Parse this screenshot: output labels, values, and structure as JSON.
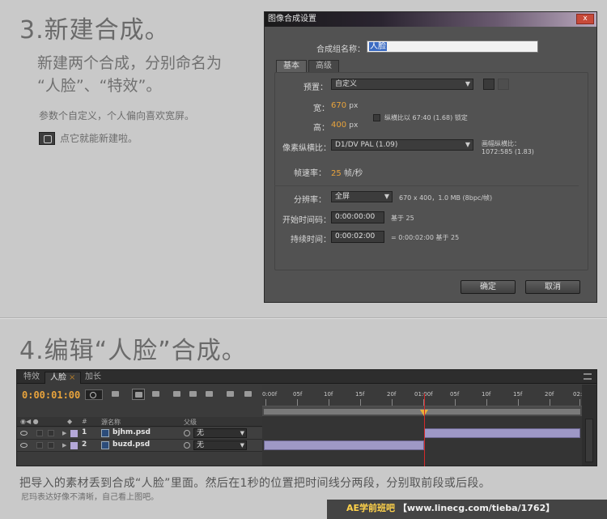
{
  "section3": {
    "title": "3.新建合成。",
    "lead_line1": "新建两个合成，分别命名为",
    "lead_line2": "“人脸”、“特效”。",
    "note": "参数个自定义，个人偏向喜欢宽屏。",
    "hint": "点它就能新建啦。"
  },
  "dialog": {
    "title": "图像合成设置",
    "close_label": "x",
    "name_label": "合成组名称：",
    "name_value": "人脸",
    "tabs": [
      "基本",
      "高级"
    ],
    "preset_label": "预置：",
    "preset_value": "自定义",
    "width_label": "宽：",
    "width_value": "670",
    "height_label": "高：",
    "height_value": "400",
    "unit_px": "px",
    "lock_ratio_label": "纵横比以 67:40 (1.68) 锁定",
    "pixel_aspect_label": "像素纵横比：",
    "pixel_aspect_value": "D1/DV PAL (1.09)",
    "frame_aspect_label": "画幅纵横比：",
    "frame_aspect_value": "1072:585 (1.83)",
    "frame_rate_label": "帧速率：",
    "frame_rate_value": "25",
    "frame_rate_unit": "帧/秒",
    "resolution_label": "分辨率：",
    "resolution_value": "全屏",
    "resolution_info": "670 x 400，1.0 MB (8bpc/帧)",
    "start_timecode_label": "开始时间码：",
    "start_timecode_value": "0:00:00:00",
    "start_timecode_base": "基于 25",
    "duration_label": "持续时间：",
    "duration_value": "0:00:02:00",
    "duration_info": "= 0:00:02:00  基于 25",
    "ok_label": "确定",
    "cancel_label": "取消"
  },
  "section4": {
    "title": "4.编辑“人脸”合成。",
    "description": "把导入的素材丢到合成“人脸”里面。然后在1秒的位置把时间线分两段，分别取前段或后段。",
    "note": "尼玛表达好像不清晰，自己看上图吧。"
  },
  "timeline": {
    "tabs": [
      "特效",
      "人脸",
      "加长"
    ],
    "active_tab_close": "×",
    "timecode": "0:00:01:00",
    "col_name_header": "源名称",
    "col_parent_header": "父级",
    "col_num_header": "#",
    "ruler_labels": [
      "0:00f",
      "05f",
      "10f",
      "15f",
      "20f",
      "01:00f",
      "05f",
      "10f",
      "15f",
      "20f",
      "02:0"
    ],
    "layers": [
      {
        "num": "1",
        "name": "bjhm.psd",
        "parent": "无"
      },
      {
        "num": "2",
        "name": "buzd.psd",
        "parent": "无"
      }
    ]
  },
  "footer": {
    "brand": "AE学前班吧",
    "url": "【www.linecg.com/tieba/1762】"
  },
  "colors": {
    "accent_orange": "#e8a33c",
    "layer_bar": "#9e98c6",
    "playhead": "#d42a2a",
    "dialog_bg": "#525252"
  },
  "icons": [
    "new-composition-icon",
    "search-icon",
    "eye-icon",
    "psd-file-icon",
    "parent-pickwhip-icon",
    "menu-icon",
    "delete-icon",
    "save-preset-icon"
  ]
}
